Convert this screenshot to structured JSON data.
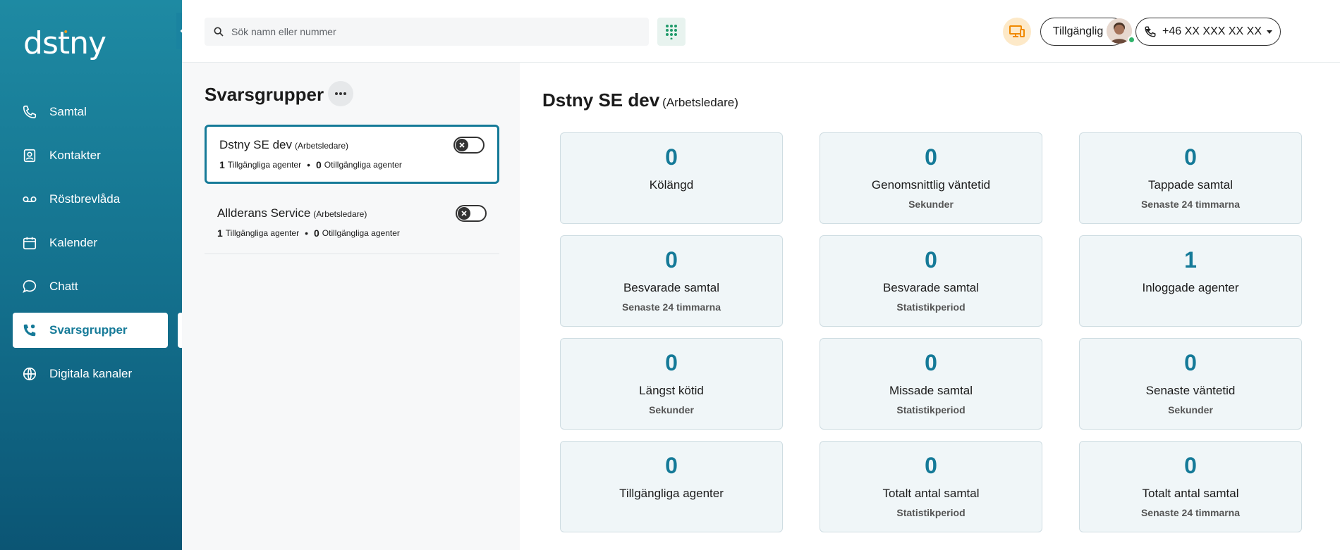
{
  "app": {
    "logo": "dstny"
  },
  "colors": {
    "brand": "#157a98",
    "accent": "#f59a1b",
    "status_online": "#2fb36a"
  },
  "sidebar": {
    "items": [
      {
        "label": "Samtal",
        "icon": "phone-icon"
      },
      {
        "label": "Kontakter",
        "icon": "contact-card-icon"
      },
      {
        "label": "Röstbrevlåda",
        "icon": "voicemail-icon"
      },
      {
        "label": "Kalender",
        "icon": "calendar-icon"
      },
      {
        "label": "Chatt",
        "icon": "chat-bubble-icon"
      },
      {
        "label": "Svarsgrupper",
        "icon": "phone-hand-icon",
        "active": true
      },
      {
        "label": "Digitala kanaler",
        "icon": "globe-icon"
      }
    ]
  },
  "topbar": {
    "search_placeholder": "Sök namn eller nummer",
    "status_label": "Tillgänglig",
    "phone_label": "+46 XX XXX XX XX"
  },
  "groups_panel": {
    "title": "Svarsgrupper",
    "groups": [
      {
        "name": "Dstny SE dev",
        "role": "(Arbetsledare)",
        "available_count": "1",
        "available_label": "Tillgängliga agenter",
        "unavailable_count": "0",
        "unavailable_label": "Otillgängliga agenter",
        "selected": true,
        "toggle_on": false
      },
      {
        "name": "Allderans Service",
        "role": "(Arbetsledare)",
        "available_count": "1",
        "available_label": "Tillgängliga agenter",
        "unavailable_count": "0",
        "unavailable_label": "Otillgängliga agenter",
        "selected": false,
        "toggle_on": false
      }
    ]
  },
  "main": {
    "title": "Dstny SE dev",
    "role": "(Arbetsledare)",
    "stats": [
      {
        "value": "0",
        "label": "Kölängd",
        "sub": ""
      },
      {
        "value": "0",
        "label": "Genomsnittlig väntetid",
        "sub": "Sekunder"
      },
      {
        "value": "0",
        "label": "Tappade samtal",
        "sub": "Senaste 24 timmarna"
      },
      {
        "value": "0",
        "label": "Besvarade samtal",
        "sub": "Senaste 24 timmarna"
      },
      {
        "value": "0",
        "label": "Besvarade samtal",
        "sub": "Statistikperiod"
      },
      {
        "value": "1",
        "label": "Inloggade agenter",
        "sub": ""
      },
      {
        "value": "0",
        "label": "Längst kötid",
        "sub": "Sekunder"
      },
      {
        "value": "0",
        "label": "Missade samtal",
        "sub": "Statistikperiod"
      },
      {
        "value": "0",
        "label": "Senaste väntetid",
        "sub": "Sekunder"
      },
      {
        "value": "0",
        "label": "Tillgängliga agenter",
        "sub": ""
      },
      {
        "value": "0",
        "label": "Totalt antal samtal",
        "sub": "Statistikperiod"
      },
      {
        "value": "0",
        "label": "Totalt antal samtal",
        "sub": "Senaste 24 timmarna"
      }
    ]
  }
}
